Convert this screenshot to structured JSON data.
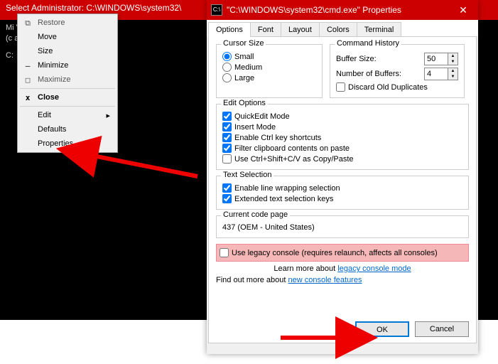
{
  "cmdTitle": "Select Administrator: C:\\WINDOWS\\system32\\",
  "termLine1": "Mi                    Version 10.0.19(",
  "termLine2": "(c                    ation. All righ",
  "termLine3": "C:",
  "ctx": {
    "restore": "Restore",
    "move": "Move",
    "size": "Size",
    "minimize": "Minimize",
    "maximize": "Maximize",
    "close": "Close",
    "edit": "Edit",
    "defaults": "Defaults",
    "properties": "Properties"
  },
  "propsTitle": "\"C:\\WINDOWS\\system32\\cmd.exe\" Properties",
  "tabs": {
    "options": "Options",
    "font": "Font",
    "layout": "Layout",
    "colors": "Colors",
    "terminal": "Terminal"
  },
  "cursor": {
    "legend": "Cursor Size",
    "small": "Small",
    "medium": "Medium",
    "large": "Large"
  },
  "history": {
    "legend": "Command History",
    "buffer": "Buffer Size:",
    "bufferVal": "50",
    "num": "Number of Buffers:",
    "numVal": "4",
    "discard": "Discard Old Duplicates"
  },
  "edit": {
    "legend": "Edit Options",
    "quick": "QuickEdit Mode",
    "insert": "Insert Mode",
    "ctrl": "Enable Ctrl key shortcuts",
    "filter": "Filter clipboard contents on paste",
    "cscv": "Use Ctrl+Shift+C/V as Copy/Paste"
  },
  "sel": {
    "legend": "Text Selection",
    "wrap": "Enable line wrapping selection",
    "ext": "Extended text selection keys"
  },
  "cp": {
    "legend": "Current code page",
    "val": "437  (OEM - United States)"
  },
  "legacy": {
    "chk": "Use legacy console (requires relaunch, affects all consoles)",
    "learn": "Learn more about ",
    "link": "legacy console mode"
  },
  "find": {
    "text": "Find out more about ",
    "link": "new console features"
  },
  "btn": {
    "ok": "OK",
    "cancel": "Cancel"
  }
}
